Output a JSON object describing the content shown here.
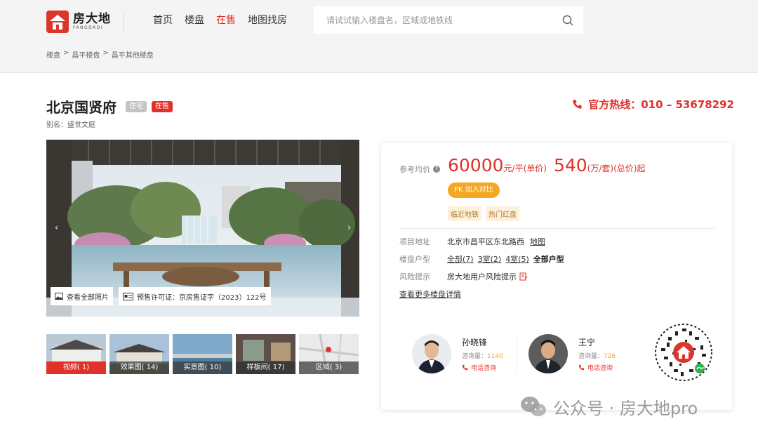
{
  "logo": {
    "cn": "房大地",
    "en": "FANGDADI"
  },
  "nav": {
    "items": [
      "首页",
      "楼盘",
      "在售",
      "地图找房"
    ],
    "active_index": 2
  },
  "search": {
    "placeholder": "请试试输入楼盘名，区域或地铁线",
    "value": ""
  },
  "breadcrumb": [
    "楼盘",
    "昌平楼盘",
    "昌平其他楼盘"
  ],
  "property": {
    "title": "北京国贤府",
    "tag_type": "住宅",
    "tag_status": "在售",
    "alias": "别名：盛世文庭",
    "hotline": "官方热线：010 – 53678292"
  },
  "gallery": {
    "all_photos": "查看全部照片",
    "license": "预售许可证：京房售证字（2023）122号",
    "thumbs": [
      "视频( 1)",
      "效果图( 14)",
      "实景图( 10)",
      "样板间( 17)",
      "区域( 3)"
    ]
  },
  "price": {
    "label": "参考均价",
    "unit_price": "60000",
    "unit_price_unit": "元/平(单价)",
    "total_price": "540",
    "total_price_unit": "(万/套)(总价)起",
    "pk": "PK 加入对比",
    "features": [
      "临近地铁",
      "热门红盘"
    ]
  },
  "info": {
    "address_label": "项目地址",
    "address": "北京市昌平区东北路西",
    "map_link": "地图",
    "layout_label": "楼盘户型",
    "layouts": [
      "全部(7)",
      "3室(2)",
      "4室(5)"
    ],
    "all_layouts": "全部户型",
    "risk_label": "风险提示",
    "risk": "房大地用户风险提示",
    "more": "查看更多楼盘详情"
  },
  "agents": [
    {
      "name": "孙晓锋",
      "inquiry_label": "咨询量：",
      "inquiry": "1140",
      "call": "电话咨询"
    },
    {
      "name": "王宁",
      "inquiry_label": "咨询量：",
      "inquiry": "726",
      "call": "电话咨询"
    }
  ],
  "watermark": "公众号 · 房大地pro",
  "colors": {
    "accent": "#e0312a",
    "orange": "#f5a623"
  }
}
